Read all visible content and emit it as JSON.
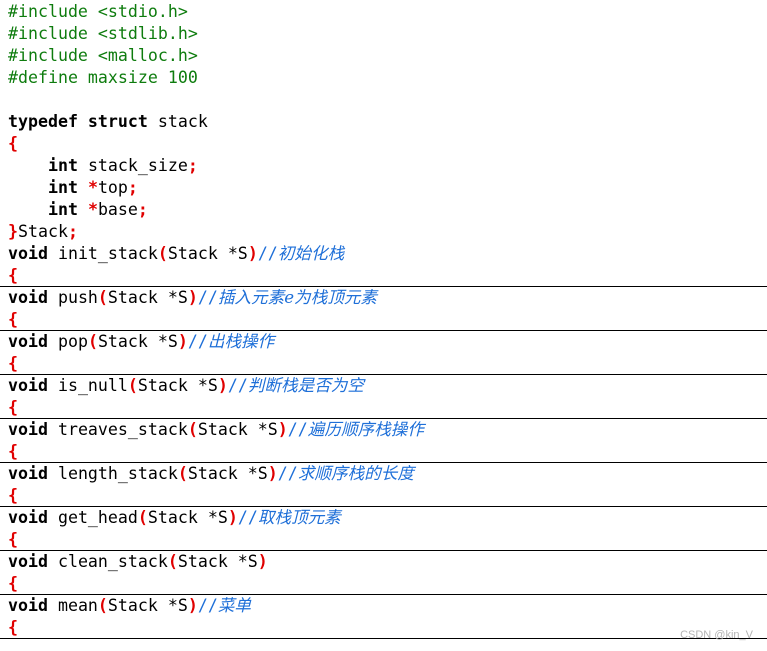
{
  "code": {
    "includes": [
      "#include <stdio.h>",
      "#include <stdlib.h>",
      "#include <malloc.h>"
    ],
    "define": "#define maxsize 100",
    "typedef_kw": "typedef struct",
    "typedef_name": " stack",
    "open_brace": "{",
    "close_brace": "}",
    "field_type": "int",
    "field1": " stack_size",
    "field2_ptr": " *",
    "field2": "top",
    "field3": "base",
    "semicolon": ";",
    "struct_alias": "Stack",
    "void_kw": "void",
    "functions": [
      {
        "name": " init_stack",
        "param": "Stack *S",
        "comment": "初始化栈"
      },
      {
        "name": " push",
        "param": "Stack *S",
        "comment": "插入元素e为栈顶元素"
      },
      {
        "name": " pop",
        "param": "Stack *S",
        "comment": "出栈操作"
      },
      {
        "name": " is_null",
        "param": "Stack *S",
        "comment": "判断栈是否为空"
      },
      {
        "name": " treaves_stack",
        "param": "Stack *S",
        "comment": "遍历顺序栈操作"
      },
      {
        "name": " length_stack",
        "param": "Stack *S",
        "comment": "求顺序栈的长度"
      },
      {
        "name": " get_head",
        "param": "Stack *S",
        "comment": "取栈顶元素"
      },
      {
        "name": " clean_stack",
        "param": "Stack *S",
        "comment": ""
      },
      {
        "name": " mean",
        "param": "Stack *S",
        "comment": "菜单"
      }
    ],
    "paren_open": "(",
    "paren_close": ")",
    "comment_slash": "//"
  },
  "watermark": "CSDN @kin_V"
}
